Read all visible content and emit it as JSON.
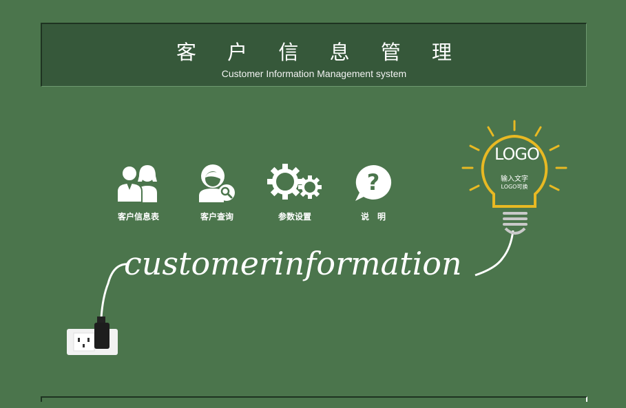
{
  "header": {
    "title": "客 户 信 息 管 理",
    "subtitle": "Customer Information Management system"
  },
  "menu": [
    {
      "label": "客户信息表",
      "icon": "users-icon"
    },
    {
      "label": "客户查询",
      "icon": "user-search-icon"
    },
    {
      "label": "参数设置",
      "icon": "gears-icon"
    },
    {
      "label": "说　明",
      "icon": "question-bubble-icon"
    }
  ],
  "decoration": {
    "cursive_text": "customerinformation",
    "bulb_logo": "LOGO",
    "bulb_line1": "输入文字",
    "bulb_line2": "LOGO可换"
  },
  "colors": {
    "background": "#4b754c",
    "header_bg": "#36583a",
    "bulb": "#e8b923"
  }
}
